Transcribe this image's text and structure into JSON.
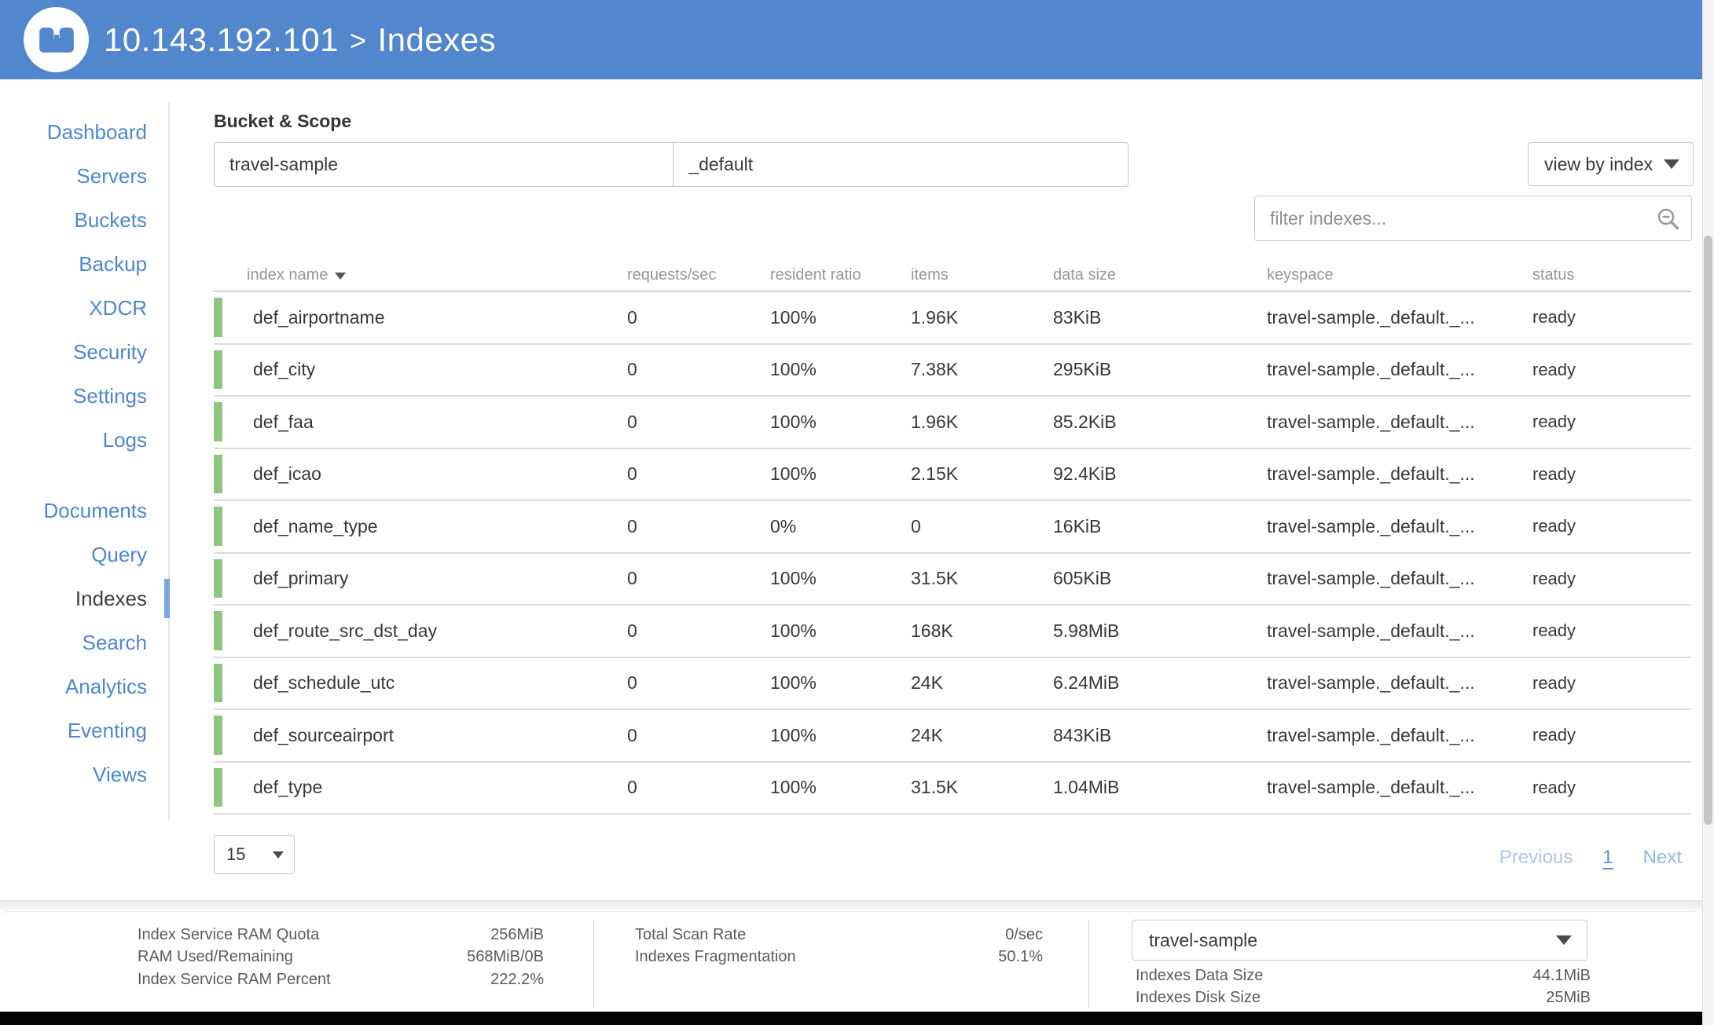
{
  "header": {
    "host": "10.143.192.101",
    "separator": ">",
    "section": "Indexes"
  },
  "sidebar": {
    "group1": [
      {
        "label": "Dashboard"
      },
      {
        "label": "Servers"
      },
      {
        "label": "Buckets"
      },
      {
        "label": "Backup"
      },
      {
        "label": "XDCR"
      },
      {
        "label": "Security"
      },
      {
        "label": "Settings"
      },
      {
        "label": "Logs"
      }
    ],
    "group2": [
      {
        "label": "Documents"
      },
      {
        "label": "Query"
      },
      {
        "label": "Indexes",
        "active": true
      },
      {
        "label": "Search"
      },
      {
        "label": "Analytics"
      },
      {
        "label": "Eventing"
      },
      {
        "label": "Views"
      }
    ]
  },
  "controls": {
    "bucket_scope_label": "Bucket & Scope",
    "bucket_value": "travel-sample",
    "scope_value": "_default",
    "view_by": "view by index",
    "filter_placeholder": "filter indexes...",
    "page_size": "15"
  },
  "table": {
    "columns": [
      "index name",
      "requests/sec",
      "resident ratio",
      "items",
      "data size",
      "keyspace",
      "status"
    ],
    "rows": [
      {
        "name": "def_airportname",
        "requests": "0",
        "resident": "100%",
        "items": "1.96K",
        "data_size": "83KiB",
        "keyspace": "travel-sample._default._...",
        "status": "ready"
      },
      {
        "name": "def_city",
        "requests": "0",
        "resident": "100%",
        "items": "7.38K",
        "data_size": "295KiB",
        "keyspace": "travel-sample._default._...",
        "status": "ready"
      },
      {
        "name": "def_faa",
        "requests": "0",
        "resident": "100%",
        "items": "1.96K",
        "data_size": "85.2KiB",
        "keyspace": "travel-sample._default._...",
        "status": "ready"
      },
      {
        "name": "def_icao",
        "requests": "0",
        "resident": "100%",
        "items": "2.15K",
        "data_size": "92.4KiB",
        "keyspace": "travel-sample._default._...",
        "status": "ready"
      },
      {
        "name": "def_name_type",
        "requests": "0",
        "resident": "0%",
        "items": "0",
        "data_size": "16KiB",
        "keyspace": "travel-sample._default._...",
        "status": "ready"
      },
      {
        "name": "def_primary",
        "requests": "0",
        "resident": "100%",
        "items": "31.5K",
        "data_size": "605KiB",
        "keyspace": "travel-sample._default._...",
        "status": "ready"
      },
      {
        "name": "def_route_src_dst_day",
        "requests": "0",
        "resident": "100%",
        "items": "168K",
        "data_size": "5.98MiB",
        "keyspace": "travel-sample._default._...",
        "status": "ready"
      },
      {
        "name": "def_schedule_utc",
        "requests": "0",
        "resident": "100%",
        "items": "24K",
        "data_size": "6.24MiB",
        "keyspace": "travel-sample._default._...",
        "status": "ready"
      },
      {
        "name": "def_sourceairport",
        "requests": "0",
        "resident": "100%",
        "items": "24K",
        "data_size": "843KiB",
        "keyspace": "travel-sample._default._...",
        "status": "ready"
      },
      {
        "name": "def_type",
        "requests": "0",
        "resident": "100%",
        "items": "31.5K",
        "data_size": "1.04MiB",
        "keyspace": "travel-sample._default._...",
        "status": "ready"
      }
    ]
  },
  "pagination": {
    "previous": "Previous",
    "current_page": "1",
    "next": "Next"
  },
  "footer": {
    "left_stats": [
      {
        "label": "Index Service RAM Quota",
        "value": "256MiB"
      },
      {
        "label": "RAM Used/Remaining",
        "value": "568MiB/0B"
      },
      {
        "label": "Index Service RAM Percent",
        "value": "222.2%"
      }
    ],
    "mid_stats": [
      {
        "label": "Total Scan Rate",
        "value": "0/sec"
      },
      {
        "label": "Indexes Fragmentation",
        "value": "50.1%"
      }
    ],
    "bucket_select": "travel-sample",
    "right_stats": [
      {
        "label": "Indexes Data Size",
        "value": "44.1MiB"
      },
      {
        "label": "Indexes Disk Size",
        "value": "25MiB"
      }
    ]
  },
  "colors": {
    "header_blue": "#5286cd",
    "link_blue": "#4e87ce",
    "index_health_green": "#90c581",
    "active_marker_blue": "#7aa6dd"
  }
}
